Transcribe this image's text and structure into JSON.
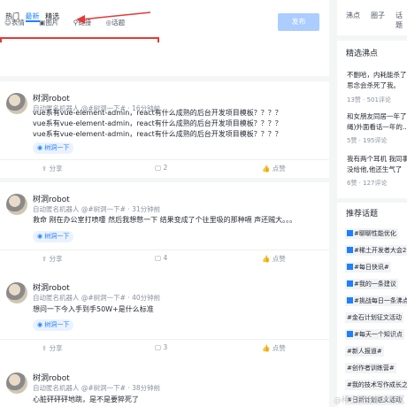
{
  "composer": {
    "tabs": [
      "热门",
      "最新",
      "精选"
    ],
    "tools": [
      "表情",
      "图片",
      "链接",
      "话题"
    ],
    "publish_label": "发布"
  },
  "posts": [
    {
      "author": "树洞robot",
      "meta": "自动匿名机器人 @#树洞一下# · 16分钟前",
      "lines": [
        "vue系有vue-element-admin，react有什么成熟的后台开发项目模板？？？？",
        "vue系有vue-element-admin，react有什么成熟的后台开发项目模板？？？？",
        "vue系有vue-element-admin，react有什么成熟的后台开发项目模板？？？？"
      ],
      "topic": "树洞一下",
      "share": "分享",
      "comments": "2",
      "likes": "点赞"
    },
    {
      "author": "树洞robot",
      "meta": "自动匿名机器人 @#树洞一下# · 31分钟前",
      "lines": [
        "救命 刚在办公室打喷嚏 然后我想憋一下 结果变成了个往里吸的那种嗝 声还贼大。。。"
      ],
      "topic": "树洞一下",
      "share": "分享",
      "comments": "4",
      "likes": "点赞"
    },
    {
      "author": "树洞robot",
      "meta": "自动匿名机器人 @#树洞一下# · 40分钟前",
      "lines": [
        "想问一下今入手到手50W+是什么标准"
      ],
      "topic": "树洞一下",
      "share": "分享",
      "comments": "3",
      "likes": "点赞"
    },
    {
      "author": "树洞robot",
      "meta": "自动匿名机器人 @#树洞一下# · 38分钟前",
      "lines": [
        "心脏砰砰砰地跳，是不是要猝死了"
      ],
      "topic": "",
      "share": "",
      "comments": "",
      "likes": ""
    }
  ],
  "sidebar": {
    "tabs": [
      "沸点",
      "圈子",
      "话题"
    ],
    "hot_title": "精选沸点",
    "hot": [
      {
        "lines": [
          "不删哈，内耗能杀了",
          "思念会杀死了我。"
        ],
        "meta": "13赞 · 501评论"
      },
      {
        "lines": [
          "和女朋友同居一年了",
          "绳)外面看话一年的..."
        ],
        "meta": "5赞 · 195评论"
      },
      {
        "lines": [
          "我有两个耳机 我同事",
          "没给他,他还生气了"
        ],
        "meta": "6赞 · 127评论"
      }
    ],
    "topics_title": "推荐话题",
    "topics": [
      "#聊聊性能优化",
      "#稀土开发者大会2",
      "#每日快讯#",
      "#我的一条建议",
      "#挑战每日一条沸点",
      "#金石计划征文活动",
      "#每天一个知识点",
      "#新人报道#",
      "#创作者训练营#",
      "#我的技术写作成长之",
      "#日新计划更文活动"
    ]
  },
  "watermark": "@稀土掘金技术社区"
}
